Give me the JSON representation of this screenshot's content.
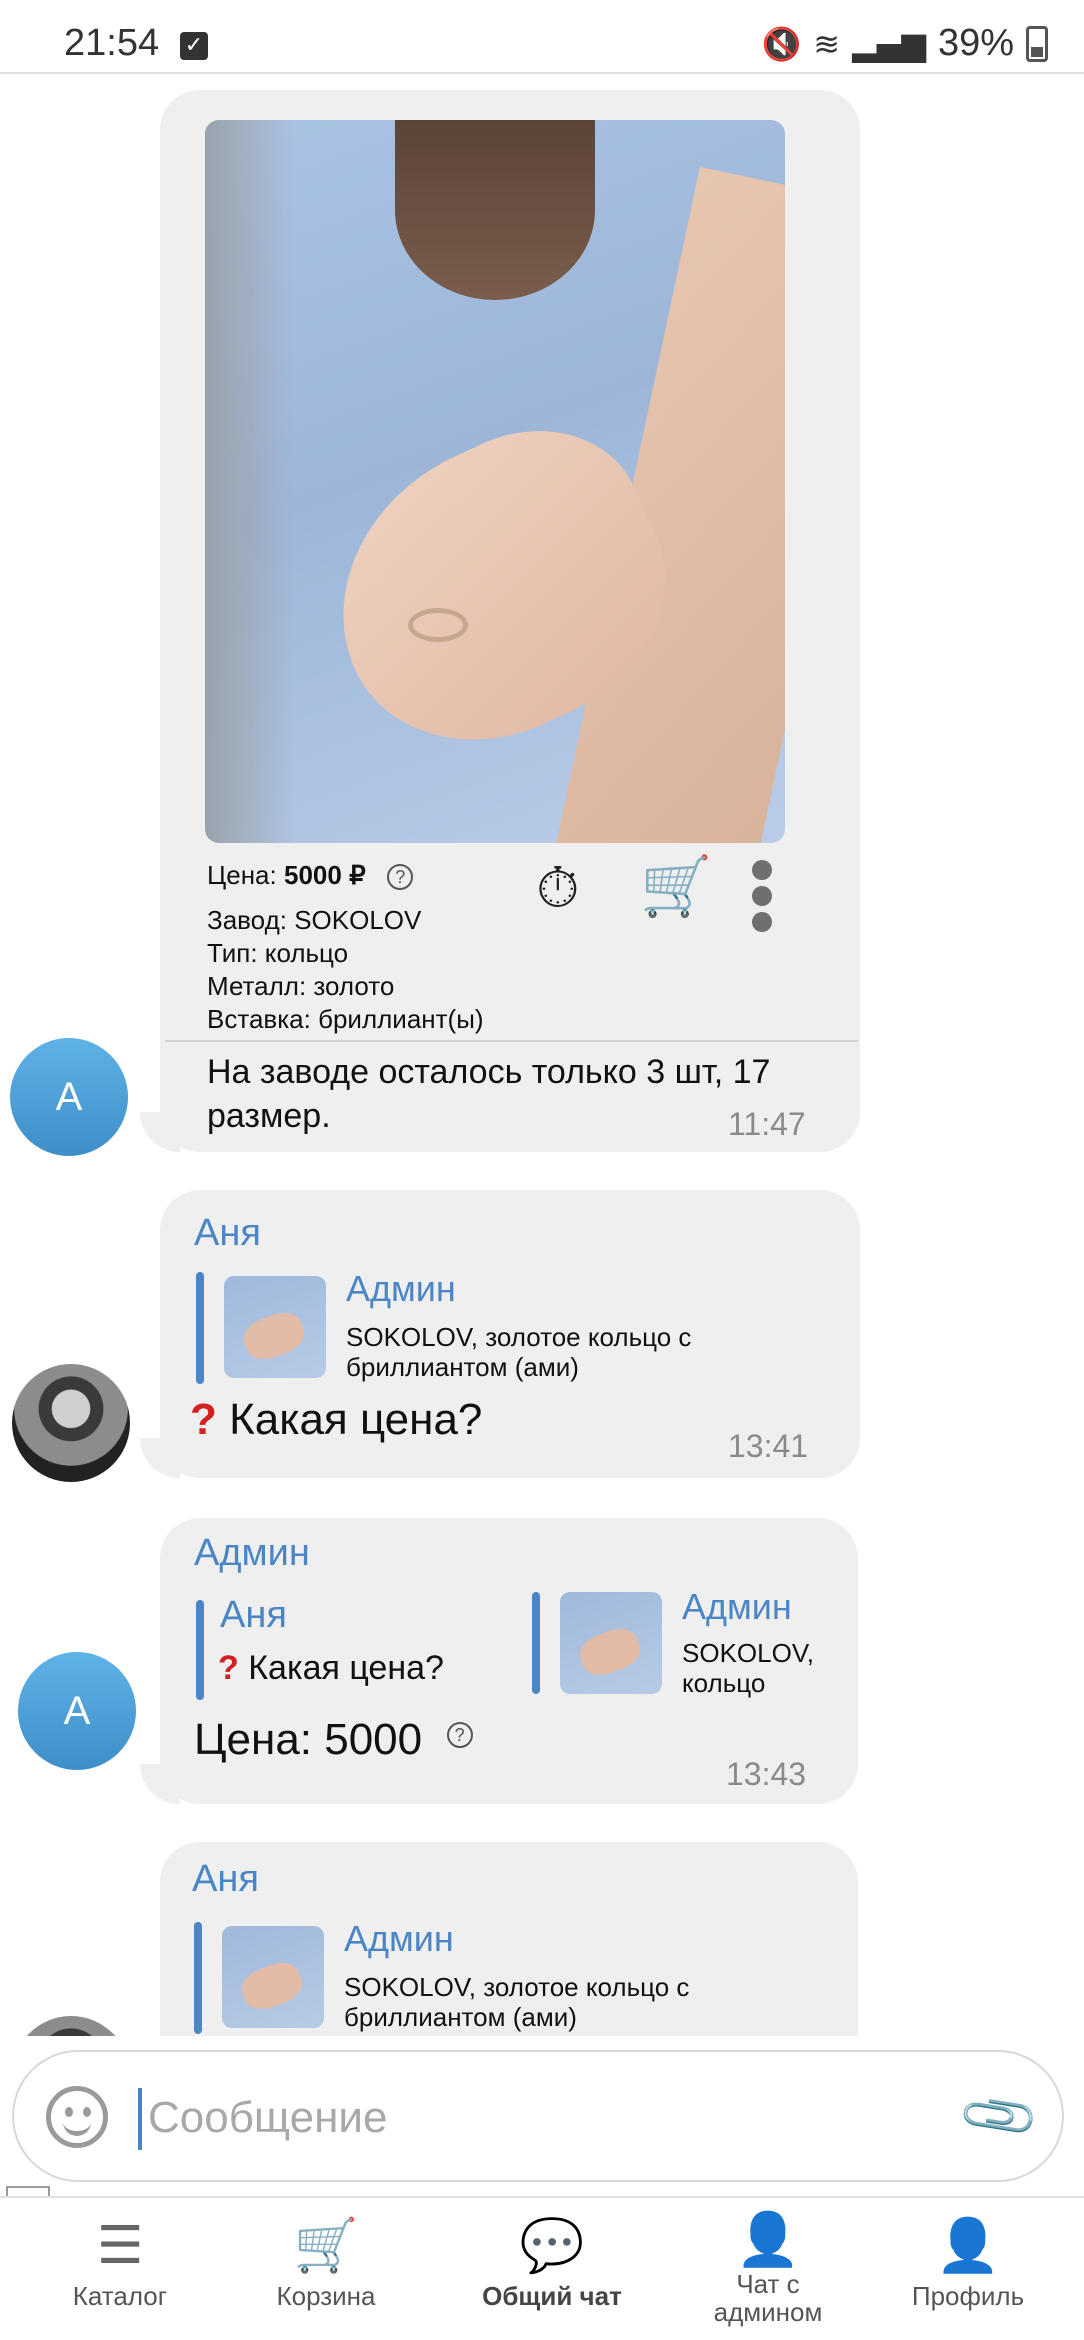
{
  "status_bar": {
    "time": "21:54",
    "battery": "39%"
  },
  "messages": [
    {
      "product": {
        "price_label": "Цена:",
        "price_value": "5000",
        "currency": "₽",
        "factory": "Завод: SOKOLOV",
        "type": "Тип: кольцо",
        "metal": "Металл: золото",
        "insert": "Вставка: бриллиант(ы)"
      },
      "avatar_letter": "A",
      "text_line1": "На заводе осталось только 3 шт, 17",
      "text_line2": "размер.",
      "time": "11:47"
    },
    {
      "sender": "Аня",
      "quote_name": "Админ",
      "quote_line1": "SOKOLOV, золотое кольцо с",
      "quote_line2": "бриллиантом (ами)",
      "text": "Какая цена?",
      "time": "13:41"
    },
    {
      "sender": "Админ",
      "avatar_letter": "A",
      "quote1_name": "Аня",
      "quote1_text": "Какая цена?",
      "quote2_name": "Админ",
      "quote2_line1": "SOKOLOV,",
      "quote2_line2": "кольцо",
      "text": "Цена: 5000",
      "time": "13:43"
    },
    {
      "sender": "Аня",
      "quote_name": "Админ",
      "quote_line1": "SOKOLOV, золотое кольцо с",
      "quote_line2": "бриллиантом (ами)"
    }
  ],
  "composer": {
    "placeholder": "Сообщение"
  },
  "nav": [
    {
      "label": "Каталог",
      "icon": "catalog-search-icon"
    },
    {
      "label": "Корзина",
      "icon": "cart-icon"
    },
    {
      "label": "Общий чат",
      "icon": "chat-bubbles-icon"
    },
    {
      "label_line1": "Чат с",
      "label_line2": "админом",
      "icon": "admin-chat-icon"
    },
    {
      "label": "Профиль",
      "icon": "profile-icon"
    }
  ],
  "colors": {
    "accent": "#4a86c5",
    "bubble": "#efefef",
    "avatar_admin": "#4a9ad6"
  }
}
